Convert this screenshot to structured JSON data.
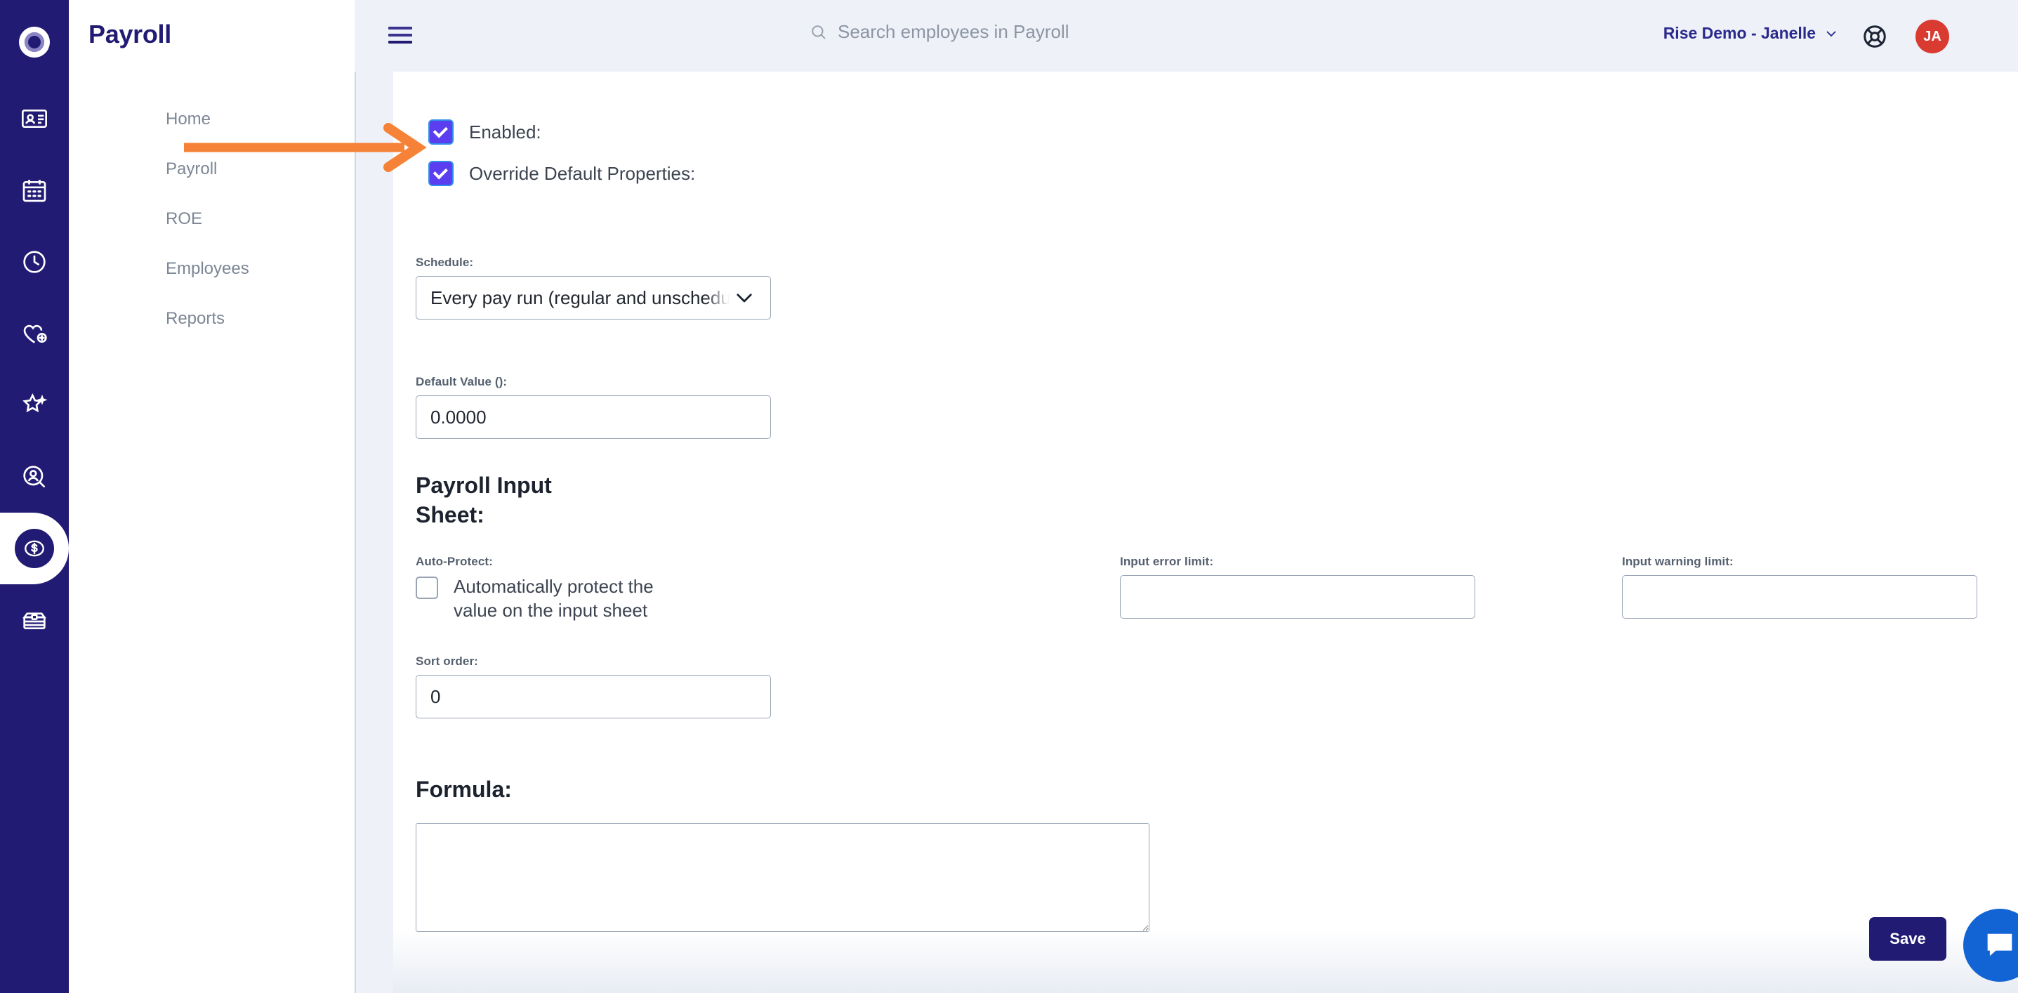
{
  "rail": {
    "logo_icon": "rise-logo-icon",
    "items": [
      {
        "icon": "id-card-icon",
        "name": "people-directory",
        "active": false
      },
      {
        "icon": "calendar-icon",
        "name": "scheduling",
        "active": false
      },
      {
        "icon": "clock-icon",
        "name": "time-tracking",
        "active": false
      },
      {
        "icon": "heart-plus-icon",
        "name": "benefits",
        "active": false
      },
      {
        "icon": "star-sparkle-icon",
        "name": "performance",
        "active": false
      },
      {
        "icon": "person-search-icon",
        "name": "recruiting",
        "active": false
      },
      {
        "icon": "dollar-circle-icon",
        "name": "payroll",
        "active": true
      },
      {
        "icon": "briefcase-icon",
        "name": "admin",
        "active": false
      }
    ]
  },
  "sidebar": {
    "title": "Payroll",
    "items": [
      {
        "label": "Home"
      },
      {
        "label": "Payroll"
      },
      {
        "label": "ROE"
      },
      {
        "label": "Employees"
      },
      {
        "label": "Reports"
      }
    ]
  },
  "topbar": {
    "menu_icon": "hamburger-menu-icon",
    "search": {
      "icon": "search-icon",
      "placeholder": "Search employees in Payroll",
      "value": ""
    },
    "org_switcher": {
      "label": "Rise Demo - Janelle",
      "chevron_icon": "chevron-down-icon"
    },
    "help_icon": "life-ring-icon",
    "avatar": {
      "initials": "JA",
      "color": "#d93b30"
    }
  },
  "form": {
    "enabled": {
      "label": "Enabled:",
      "checked": true
    },
    "override_defaults": {
      "label": "Override Default Properties:",
      "checked": true
    },
    "schedule": {
      "label": "Schedule:",
      "value": "Every pay run (regular and unscheduled)",
      "chevron_icon": "chevron-down-icon"
    },
    "default_value": {
      "label": "Default Value ():",
      "value": "0.0000"
    },
    "payroll_input_sheet": {
      "heading": "Payroll Input Sheet:",
      "auto_protect": {
        "label": "Auto-Protect:",
        "option_text": "Automatically protect the value on the input sheet",
        "checked": false
      },
      "input_warning_limit": {
        "label": "Input warning limit:",
        "value": ""
      },
      "input_error_limit": {
        "label": "Input error limit:",
        "value": ""
      }
    },
    "sort_order": {
      "label": "Sort order:",
      "value": "0"
    },
    "formula": {
      "heading": "Formula:",
      "value": ""
    }
  },
  "actions": {
    "save_label": "Save"
  },
  "chat": {
    "icon": "chat-bubble-icon"
  },
  "annotation": {
    "arrow_color": "#f58236",
    "points_at": "Override Default Properties:"
  },
  "colors": {
    "rail_navy": "#221b74",
    "accent_purple": "#5b3ef0",
    "annotation_orange": "#f58236",
    "page_bg": "#eef1f8"
  }
}
